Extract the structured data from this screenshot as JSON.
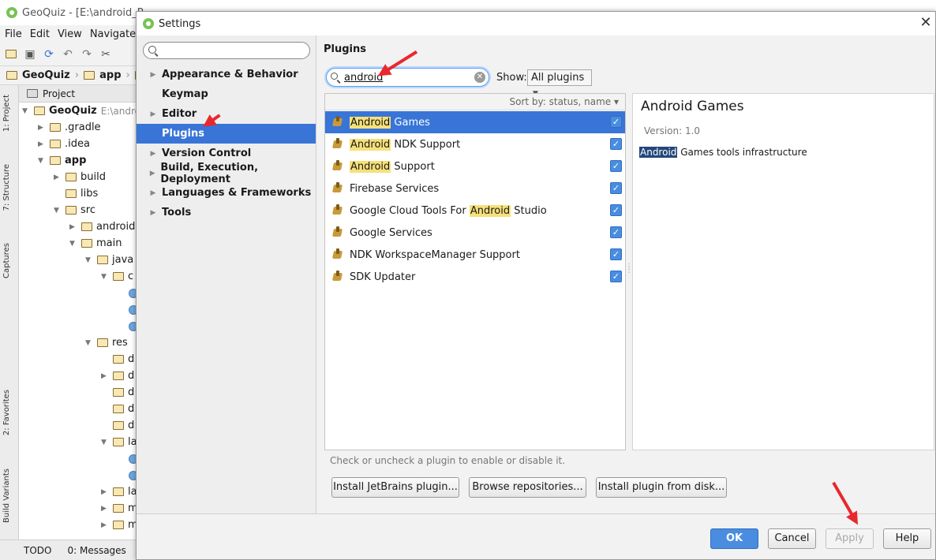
{
  "ide": {
    "window_title": "GeoQuiz - [E:\\android_P",
    "menu": [
      "File",
      "Edit",
      "View",
      "Navigate"
    ],
    "breadcrumb": [
      "GeoQuiz",
      "app",
      "s"
    ],
    "project_tab": "Project",
    "side_tabs": [
      "1: Project",
      "7: Structure",
      "Captures",
      "2: Favorites",
      "Build Variants"
    ],
    "tree": [
      {
        "label": "GeoQuiz",
        "suffix": "E:\\andro",
        "level": 0,
        "bold": true
      },
      {
        "label": ".gradle",
        "level": 1
      },
      {
        "label": ".idea",
        "level": 1
      },
      {
        "label": "app",
        "level": 1,
        "bold": true
      },
      {
        "label": "build",
        "level": 2
      },
      {
        "label": "libs",
        "level": 2
      },
      {
        "label": "src",
        "level": 2
      },
      {
        "label": "android",
        "level": 3
      },
      {
        "label": "main",
        "level": 3
      },
      {
        "label": "java",
        "level": 4
      },
      {
        "label": "c",
        "level": 5
      },
      {
        "label": "",
        "level": 6
      },
      {
        "label": "",
        "level": 6
      },
      {
        "label": "",
        "level": 6
      },
      {
        "label": "res",
        "level": 4
      },
      {
        "label": "d",
        "level": 5
      },
      {
        "label": "d",
        "level": 5
      },
      {
        "label": "d",
        "level": 5
      },
      {
        "label": "d",
        "level": 5
      },
      {
        "label": "d",
        "level": 5
      },
      {
        "label": "la",
        "level": 5
      },
      {
        "label": "",
        "level": 6
      },
      {
        "label": "",
        "level": 6
      },
      {
        "label": "la",
        "level": 5
      },
      {
        "label": "m",
        "level": 5
      },
      {
        "label": "m",
        "level": 5
      }
    ],
    "bottom_tabs": [
      "TODO",
      "0: Messages"
    ]
  },
  "dialog": {
    "title": "Settings",
    "close_glyph": "✕",
    "search_placeholder": "",
    "nav": [
      {
        "label": "Appearance & Behavior",
        "expandable": true
      },
      {
        "label": "Keymap",
        "expandable": false
      },
      {
        "label": "Editor",
        "expandable": true
      },
      {
        "label": "Plugins",
        "expandable": false,
        "selected": true
      },
      {
        "label": "Version Control",
        "expandable": true
      },
      {
        "label": "Build, Execution, Deployment",
        "expandable": true
      },
      {
        "label": "Languages & Frameworks",
        "expandable": true
      },
      {
        "label": "Tools",
        "expandable": true
      }
    ],
    "plugins": {
      "heading": "Plugins",
      "search_value": "android",
      "show_label": "Show:",
      "show_value": "All plugins",
      "sort_label": "Sort by: status, name ▾",
      "items": [
        {
          "pre": "",
          "match": "Android",
          "post": " Games",
          "checked": true,
          "selected": true
        },
        {
          "pre": "",
          "match": "Android",
          "post": " NDK Support",
          "checked": true
        },
        {
          "pre": "",
          "match": "Android",
          "post": " Support",
          "checked": true
        },
        {
          "pre": "Firebase Services",
          "match": "",
          "post": "",
          "checked": true
        },
        {
          "pre": "Google Cloud Tools For ",
          "match": "Android",
          "post": " Studio",
          "checked": true
        },
        {
          "pre": "Google Services",
          "match": "",
          "post": "",
          "checked": true
        },
        {
          "pre": "NDK WorkspaceManager Support",
          "match": "",
          "post": "",
          "checked": true
        },
        {
          "pre": "SDK Updater",
          "match": "",
          "post": "",
          "checked": true
        }
      ],
      "detail": {
        "title": "Android Games",
        "version": "Version: 1.0",
        "desc_highlight": "Android",
        "desc_rest": " Games tools infrastructure"
      },
      "hint": "Check or uncheck a plugin to enable or disable it.",
      "install_jetbrains": "Install JetBrains plugin...",
      "browse_repos": "Browse repositories...",
      "install_disk": "Install plugin from disk..."
    },
    "buttons": {
      "ok": "OK",
      "cancel": "Cancel",
      "apply": "Apply",
      "help": "Help"
    }
  },
  "colors": {
    "selection": "#3875d7",
    "match_highlight": "#f6e07a",
    "annotation_arrow": "#e8282e"
  }
}
